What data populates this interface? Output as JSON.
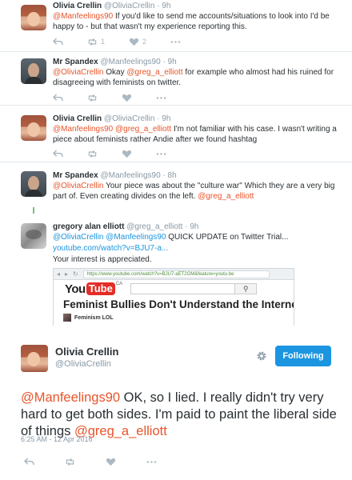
{
  "tweets": [
    {
      "name": "Olivia Crellin",
      "handle": "@OliviaCrellin",
      "time": "· 9h",
      "mention": "@Manfeelings90",
      "text": " If you'd like to send me accounts/situations to look into I'd be happy to - but that wasn't my experience reporting this.",
      "retweets": "1",
      "likes": "2"
    },
    {
      "name": "Mr Spandex",
      "handle": "@Manfeelings90",
      "time": "· 9h",
      "mention1": "@OliviaCrellin",
      "text1": " Okay ",
      "mention2": "@greg_a_elliott",
      "text2": " for example who almost had his ruined for disagreeing with feminists on twitter."
    },
    {
      "name": "Olivia Crellin",
      "handle": "@OliviaCrellin",
      "time": "· 9h",
      "mention1": "@Manfeelings90",
      "mention2": "@greg_a_elliott",
      "text": "  I'm not familiar with his case. I wasn't writing a piece about feminists rather Andie after we found hashtag"
    },
    {
      "name": "Mr Spandex",
      "handle": "@Manfeelings90",
      "time": "· 8h",
      "mention1": "@OliviaCrellin",
      "text": " Your piece was about the \"culture war\" Which they are a very big part of. Even creating divides on the left. ",
      "mention2": "@greg_a_elliott"
    }
  ],
  "greg": {
    "name": "gregory alan elliott",
    "handle": "@greg_a_elliott",
    "time": "· 9h",
    "mention1": "@OliviaCrellin",
    "mention2": "@Manfeelings90",
    "text": " QUICK UPDATE on Twitter Trial...",
    "link": "youtube.com/watch?v=BJU7-a...",
    "line3": "Your interest is appreciated.",
    "card": {
      "url": "https://www.youtube.com/watch?v=BJU7-aET2GM&feature=youtu.be",
      "logo_you": "You",
      "logo_tube": "Tube",
      "logo_region": "CA",
      "title": "Feminist Bullies Don't Understand the Internet",
      "channel": "Feminism LOL"
    }
  },
  "main": {
    "name": "Olivia Crellin",
    "handle": "@OliviaCrellin",
    "follow_label": "Following",
    "mention1": "@Manfeelings90",
    "text": " OK, so I lied. I really didn't try very hard to get both sides. I'm paid to paint the liberal side of things ",
    "mention2": "@greg_a_elliott",
    "timestamp": "6:25 AM - 12 Apr 2016"
  },
  "colors": {
    "mention": "#e8542a",
    "follow_button": "#1b95e0",
    "thread_line": "#74c27c",
    "muted": "#8899a6"
  }
}
